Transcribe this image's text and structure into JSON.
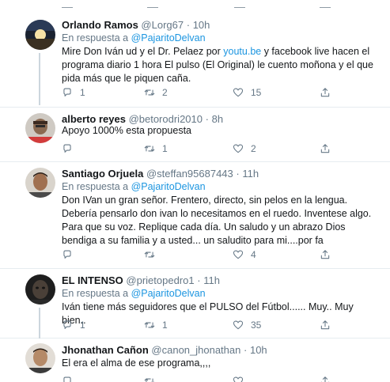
{
  "tweets": [
    {
      "name": "Orlando Ramos",
      "handle": "@Lorg67",
      "dot": "·",
      "time": "10h",
      "reply_prefix": "En respuesta a",
      "reply_to": "@PajaritoDelvan",
      "text_before_link": "Mire Don Iván ud y el Dr. Pelaez por ",
      "link": "youtu.be",
      "text_after_link": " y facebook live hacen el programa diario 1 hora El pulso (El Original) le cuento moñona y el que pida más que le piquen caña.",
      "replies": "1",
      "retweets": "2",
      "likes": "15"
    },
    {
      "name": "alberto reyes",
      "handle": "@betorodri2010",
      "dot": "·",
      "time": "8h",
      "text": "Apoyo 1000% esta propuesta",
      "replies": "",
      "retweets": "1",
      "likes": "2"
    },
    {
      "name": "Santiago Orjuela",
      "handle": "@steffan95687443",
      "dot": "·",
      "time": "11h",
      "reply_prefix": "En respuesta a",
      "reply_to": "@PajaritoDelvan",
      "text": "Don IVan un gran señor. Frentero,  directo, sin pelos en la lengua.  Debería pensarlo don ivan lo necesitamos en el ruedo. Inventese algo. Para que su voz. Replique cada día. Un saludo y un abrazo Dios bendiga a su familia y a usted... un saludito  para mi....por fa",
      "replies": "",
      "retweets": "",
      "likes": "4"
    },
    {
      "name": "EL INTENSO",
      "handle": "@prietopedro1",
      "dot": "·",
      "time": "11h",
      "reply_prefix": "En respuesta a",
      "reply_to": "@PajaritoDelvan",
      "text": "Iván tiene más seguidores que el PULSO del Fútbol...... Muy.. Muy bien..",
      "replies": "1",
      "retweets": "1",
      "likes": "35"
    },
    {
      "name": "Jhonathan Cañon",
      "handle": "@canon_jhonathan",
      "dot": "·",
      "time": "10h",
      "text": "El era el alma de ese programa,,,,",
      "replies": "",
      "retweets": "",
      "likes": ""
    }
  ],
  "icons": {
    "reply": "reply-icon",
    "retweet": "retweet-icon",
    "like": "heart-icon",
    "share": "share-icon"
  },
  "colors": {
    "link": "#1b95e0",
    "secondary_text": "#657786",
    "icon": "#657786",
    "divider": "#e6ecf0",
    "thread_line": "#ccd6dd"
  }
}
